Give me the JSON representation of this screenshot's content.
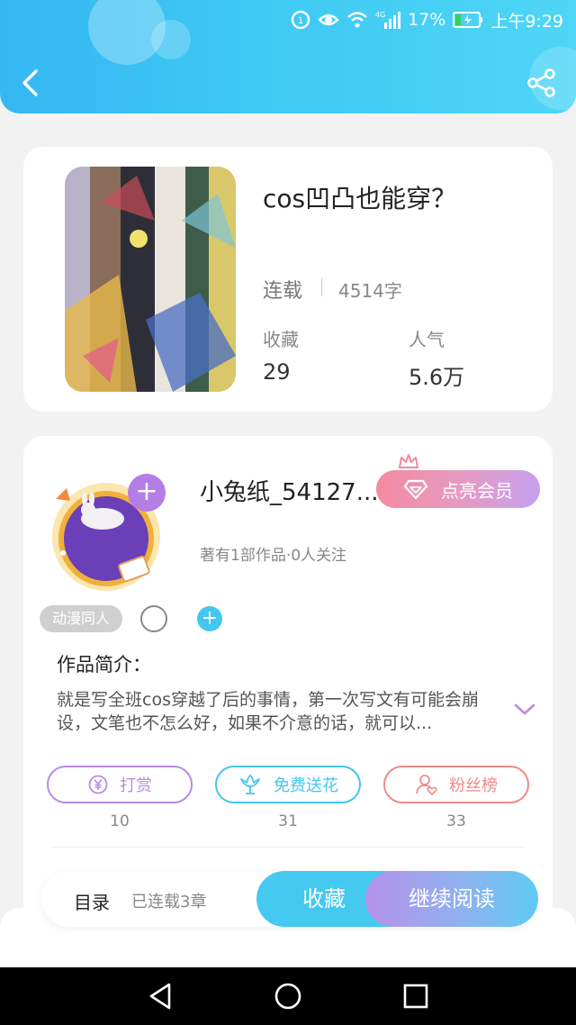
{
  "status_bar": {
    "network": "4G",
    "battery": "17%",
    "time": "上午9:29"
  },
  "header": {
    "back_icon": "back-arrow-icon",
    "share_icon": "share-icon",
    "bg_color": "#3ec9f4"
  },
  "book": {
    "title": "cos凹凸也能穿？",
    "status": "连载",
    "word_count": "4514字",
    "favorites_label": "收藏",
    "favorites_value": "29",
    "popularity_label": "人气",
    "popularity_value": "5.6万"
  },
  "author": {
    "name": "小兔纸_54127...",
    "vip_label": "点亮会员",
    "meta": "著有1部作品·0人关注",
    "tag": "动漫同人"
  },
  "intro": {
    "label": "作品简介：",
    "text": "就是写全班cos穿越了后的事情，第一次写文有可能会崩设，文笔也不怎么好，如果不介意的话，就可以..."
  },
  "actions": [
    {
      "label": "打赏",
      "count": "10",
      "color": "#b78ce6",
      "icon": "yen-coin-icon"
    },
    {
      "label": "免费送花",
      "count": "31",
      "color": "#44c6ee",
      "icon": "flower-icon"
    },
    {
      "label": "粉丝榜",
      "count": "33",
      "color": "#f08a8a",
      "icon": "fan-rank-icon"
    }
  ],
  "bottom": {
    "toc_label": "目录",
    "toc_sub": "已连载3章",
    "collect_label": "收藏",
    "read_label": "继续阅读"
  }
}
